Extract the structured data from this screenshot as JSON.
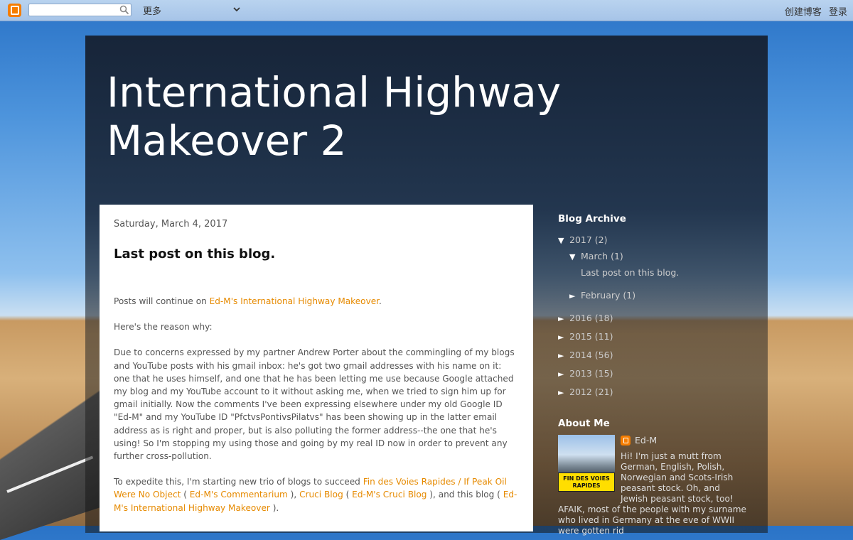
{
  "navbar": {
    "search_placeholder": "",
    "more_label": "更多",
    "create_blog": "创建博客",
    "sign_in": "登录"
  },
  "blog": {
    "title": "International Highway Makeover 2"
  },
  "post": {
    "date": "Saturday, March 4, 2017",
    "title": "Last post on this blog.",
    "p1_prefix": "Posts will continue on ",
    "p1_link": "Ed-M's International Highway Makeover",
    "p1_suffix": ".",
    "p2": "Here's the reason why:",
    "p3": "Due to concerns expressed by my partner Andrew Porter about the commingling of my blogs and YouTube posts with his gmail inbox: he's got two gmail addresses with his name on it: one that he uses himself, and one that he has been letting me use because Google attached my blog and my YouTube account to it without asking me, when we tried to sign him up for gmail initially. Now the comments I've been expressing elsewhere under my old Google ID \"Ed-M\" and my YouTube ID \"PfctvsPontivsPilatvs\" has been showing up in the latter email address as is right and proper, but is also polluting the former address--the one that he's using! So I'm stopping my using those and going by my real ID now in order to prevent any further cross-pollution.",
    "p4_a": "To expedite this, I'm starting new trio of blogs to succeed ",
    "p4_link1": "Fin des Voies Rapides / If Peak Oil Were No Object",
    "p4_b": " ( ",
    "p4_link2": "Ed-M's Commentarium",
    "p4_c": " ), ",
    "p4_link3": "Cruci Blog",
    "p4_d": " ( ",
    "p4_link4": "Ed-M's Cruci Blog",
    "p4_e": " ), and this blog ( ",
    "p4_link5": "Ed-M's International Highway Makeover",
    "p4_f": " )."
  },
  "sidebar": {
    "archive_title": "Blog Archive",
    "archive": [
      {
        "label": "2017",
        "count": "(2)",
        "toggle": "▼"
      },
      {
        "label": "March",
        "count": "(1)",
        "toggle": "▼"
      },
      {
        "label": "Last post on this blog."
      },
      {
        "label": "February",
        "count": "(1)",
        "toggle": "►"
      },
      {
        "label": "2016",
        "count": "(18)",
        "toggle": "►"
      },
      {
        "label": "2015",
        "count": "(11)",
        "toggle": "►"
      },
      {
        "label": "2014",
        "count": "(56)",
        "toggle": "►"
      },
      {
        "label": "2013",
        "count": "(15)",
        "toggle": "►"
      },
      {
        "label": "2012",
        "count": "(21)",
        "toggle": "►"
      }
    ],
    "about_title": "About Me",
    "profile_name": "Ed-M",
    "profile_sign": "FIN DES VOIES RAPIDES",
    "profile_text": "Hi! I'm just a mutt from German, English, Polish, Norwegian and Scots-Irish peasant stock. Oh, and Jewish peasant stock, too! AFAIK, most of the people with my surname who lived in Germany at the eve of WWII were gotten rid"
  }
}
